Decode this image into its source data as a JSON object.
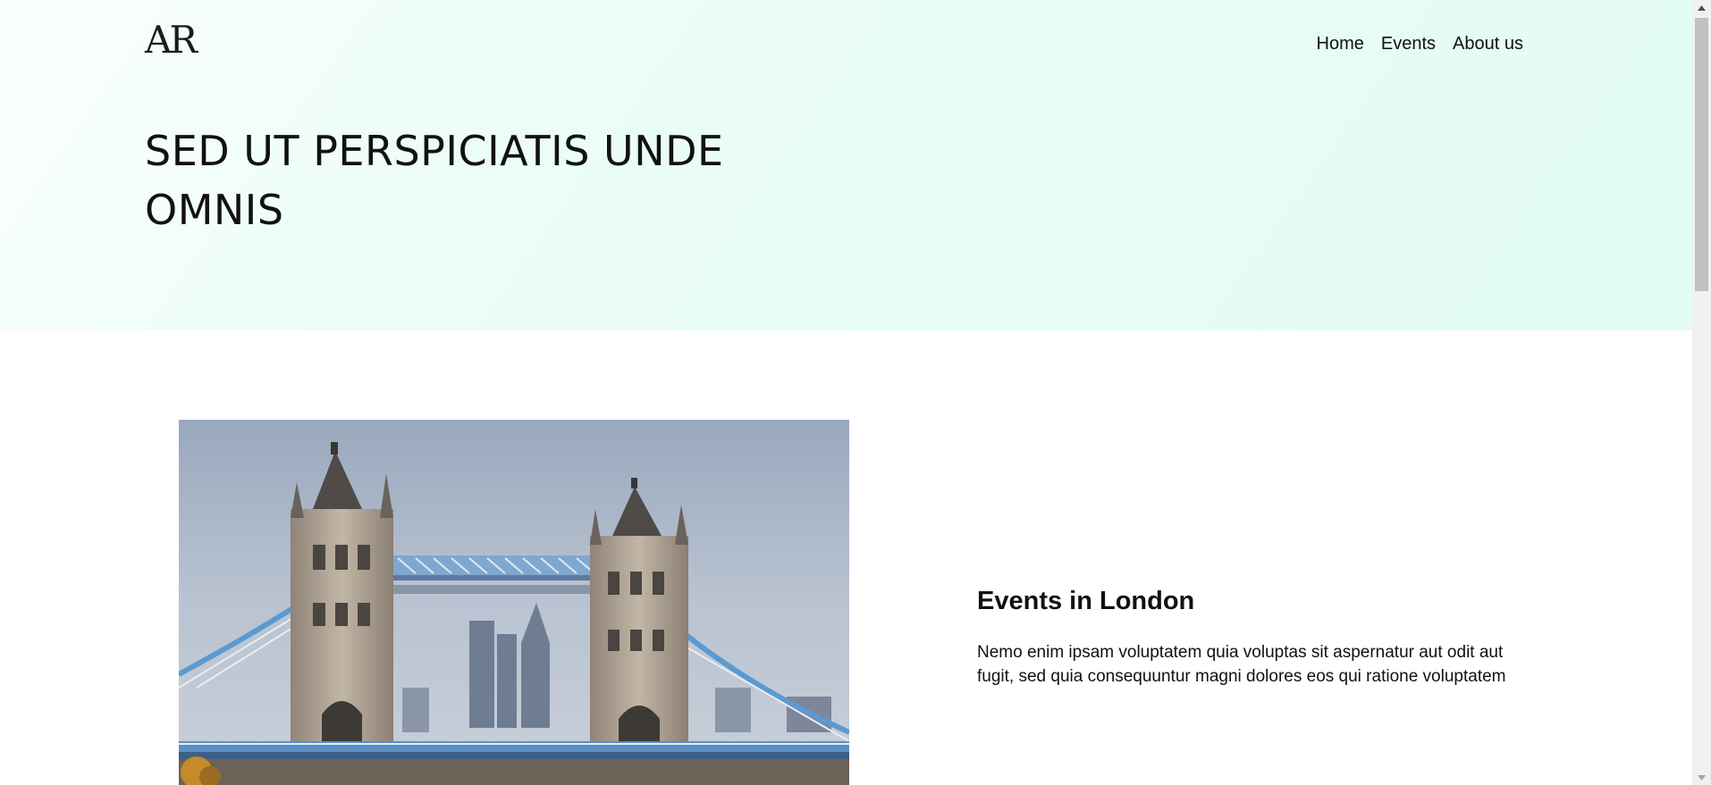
{
  "header": {
    "logo_text": "AR",
    "nav": [
      {
        "label": "Home"
      },
      {
        "label": "Events"
      },
      {
        "label": "About us"
      }
    ]
  },
  "hero": {
    "title": "SED UT PERSPICIATIS UNDE OMNIS"
  },
  "event": {
    "image_subject": "tower-bridge-london-photo",
    "title": "Events in London",
    "description": "Nemo enim ipsam voluptatem quia voluptas sit aspernatur aut odit aut fugit, sed quia consequuntur magni dolores eos qui ratione voluptatem"
  },
  "colors": {
    "hero_background": "#e6fdf3",
    "text": "#111111"
  }
}
